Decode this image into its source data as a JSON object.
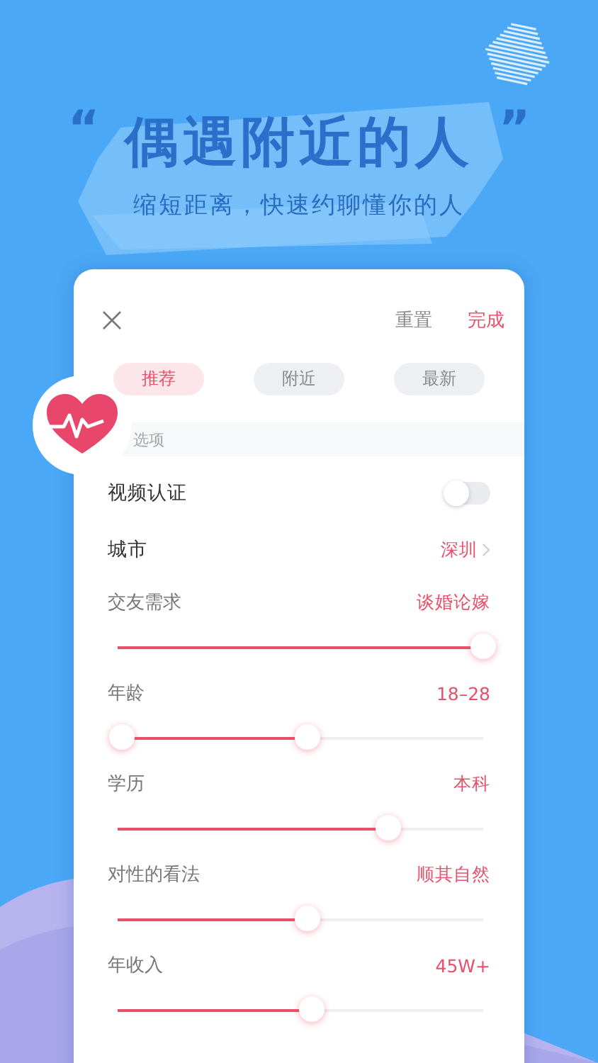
{
  "headline": {
    "open_quote": "“",
    "title": "偶遇附近的人",
    "close_quote": "”",
    "subtitle": "缩短距离，快速约聊懂你的人"
  },
  "panel": {
    "actions": [
      {
        "label": "重置",
        "kind": "secondary"
      },
      {
        "label": "完成",
        "kind": "primary"
      }
    ],
    "tabs": [
      {
        "label": "推荐",
        "selected": true
      },
      {
        "label": "附近",
        "selected": false
      },
      {
        "label": "最新",
        "selected": false
      }
    ],
    "section_title": "选项",
    "toggle_row": {
      "label": "视频认证",
      "on": false
    },
    "city_row": {
      "label": "城市",
      "value": "深圳"
    },
    "sliders": [
      {
        "label": "交友需求",
        "reading": "谈婚论嫁",
        "handles": [
          {
            "level": 1
          }
        ]
      },
      {
        "label": "年龄",
        "reading": "18–28",
        "handles": [
          {
            "level": 0.01
          },
          {
            "level": 0.52
          }
        ]
      },
      {
        "label": "学历",
        "reading": "本科",
        "handles": [
          {
            "level": 0.74
          }
        ]
      },
      {
        "label": "对性的看法",
        "reading": "顺其自然",
        "handles": [
          {
            "level": 0.52
          }
        ]
      },
      {
        "label": "年收入",
        "reading": "45W+",
        "handles": [
          {
            "level": 0.53
          }
        ]
      }
    ]
  }
}
